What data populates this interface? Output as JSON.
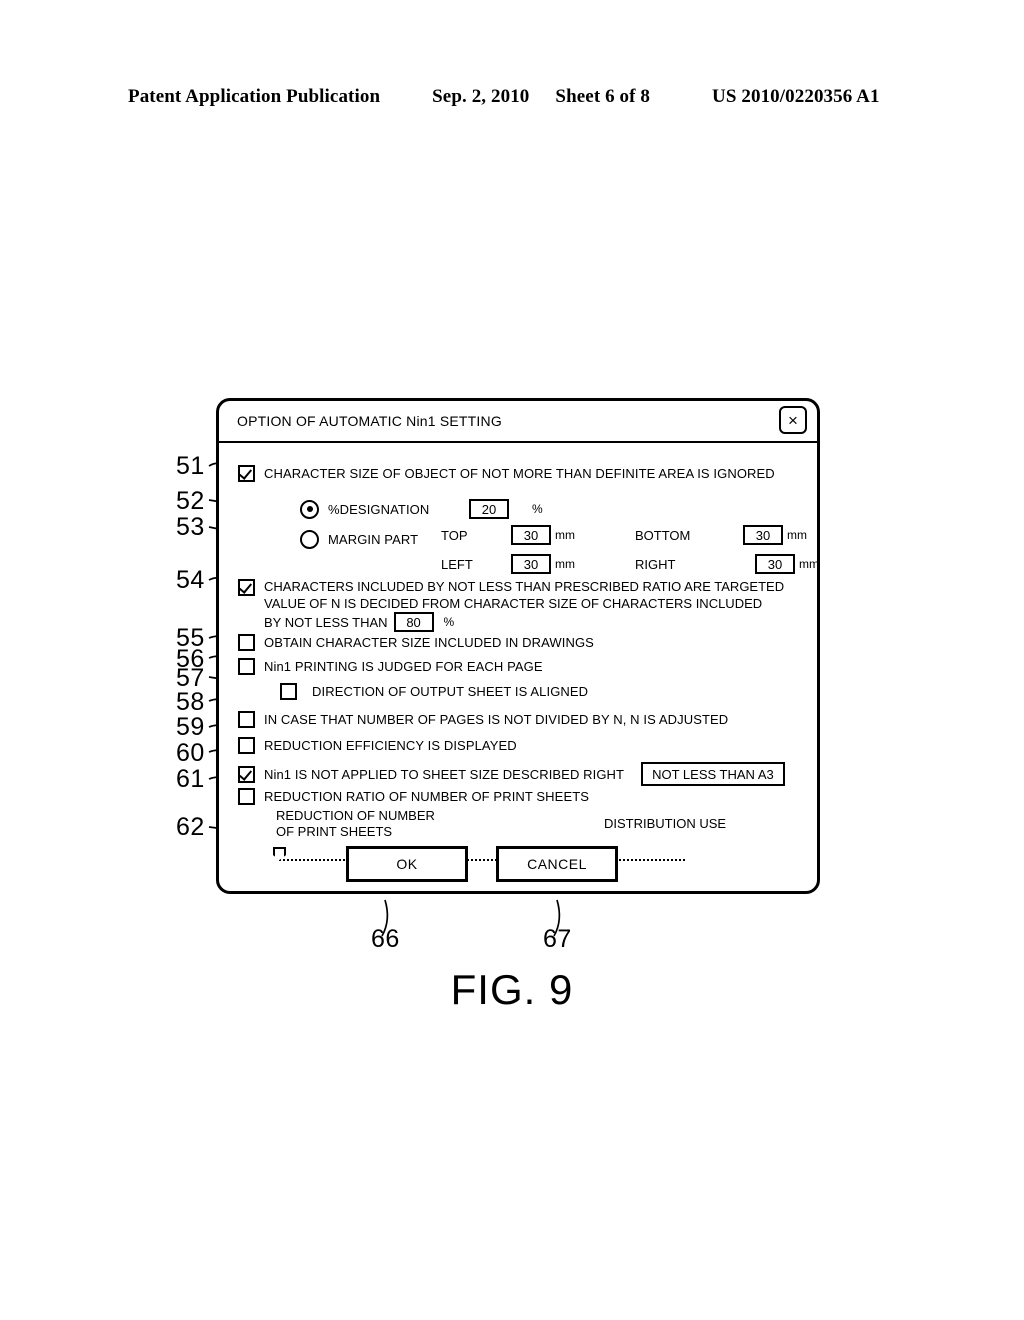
{
  "page_header": {
    "publication": "Patent Application Publication",
    "date": "Sep. 2, 2010",
    "sheet": "Sheet 6 of 8",
    "patent_number": "US 2010/0220356 A1"
  },
  "figure": {
    "caption": "FIG. 9"
  },
  "dialog": {
    "title": "OPTION OF AUTOMATIC Nin1 SETTING",
    "close_icon": "×",
    "items": {
      "item51": {
        "label": "CHARACTER SIZE OF OBJECT OF NOT MORE THAN DEFINITE AREA IS IGNORED",
        "checked": "checked"
      },
      "item52": {
        "label": "%DESIGNATION",
        "value": "20",
        "unit": "%",
        "selected": "selected"
      },
      "item53": {
        "label": "MARGIN PART",
        "selected": "",
        "top_label": "TOP",
        "top_value": "30",
        "bottom_label": "BOTTOM",
        "bottom_value": "30",
        "left_label": "LEFT",
        "left_value": "30",
        "right_label": "RIGHT",
        "right_value": "30",
        "unit": "mm"
      },
      "item54": {
        "line1": "CHARACTERS INCLUDED BY NOT LESS THAN PRESCRIBED RATIO ARE TARGETED",
        "line2": "VALUE OF N IS DECIDED FROM CHARACTER SIZE OF CHARACTERS INCLUDED",
        "line3_prefix": "BY NOT LESS THAN",
        "value": "80",
        "unit": "%",
        "checked": "checked"
      },
      "item55": {
        "label": "OBTAIN CHARACTER SIZE INCLUDED IN DRAWINGS",
        "checked": ""
      },
      "item56": {
        "label": "Nin1 PRINTING IS JUDGED FOR EACH PAGE",
        "checked": ""
      },
      "item57": {
        "label": "DIRECTION OF OUTPUT SHEET IS ALIGNED",
        "checked": ""
      },
      "item58": {
        "label": "IN CASE THAT NUMBER OF PAGES IS NOT DIVIDED BY N, N IS ADJUSTED",
        "checked": ""
      },
      "item59": {
        "label": "REDUCTION EFFICIENCY IS DISPLAYED",
        "checked": ""
      },
      "item60": {
        "label": "Nin1 IS NOT APPLIED TO SHEET SIZE DESCRIBED RIGHT",
        "checked": "checked",
        "sheet_size": "NOT LESS THAN A3"
      },
      "item61": {
        "label": "REDUCTION RATIO OF NUMBER OF PRINT SHEETS",
        "checked": ""
      },
      "item62": {
        "left_label": "REDUCTION OF NUMBER\nOF PRINT SHEETS",
        "right_label": "DISTRIBUTION USE",
        "handle_position": "0"
      }
    },
    "buttons": {
      "ok": "OK",
      "cancel": "CANCEL"
    }
  },
  "reference_numerals": {
    "n51": "51",
    "n52": "52",
    "n53": "53",
    "n54": "54",
    "n55": "55",
    "n56": "56",
    "n57": "57",
    "n58": "58",
    "n59": "59",
    "n60": "60",
    "n61": "61",
    "n62": "62",
    "n66": "66",
    "n67": "67"
  }
}
